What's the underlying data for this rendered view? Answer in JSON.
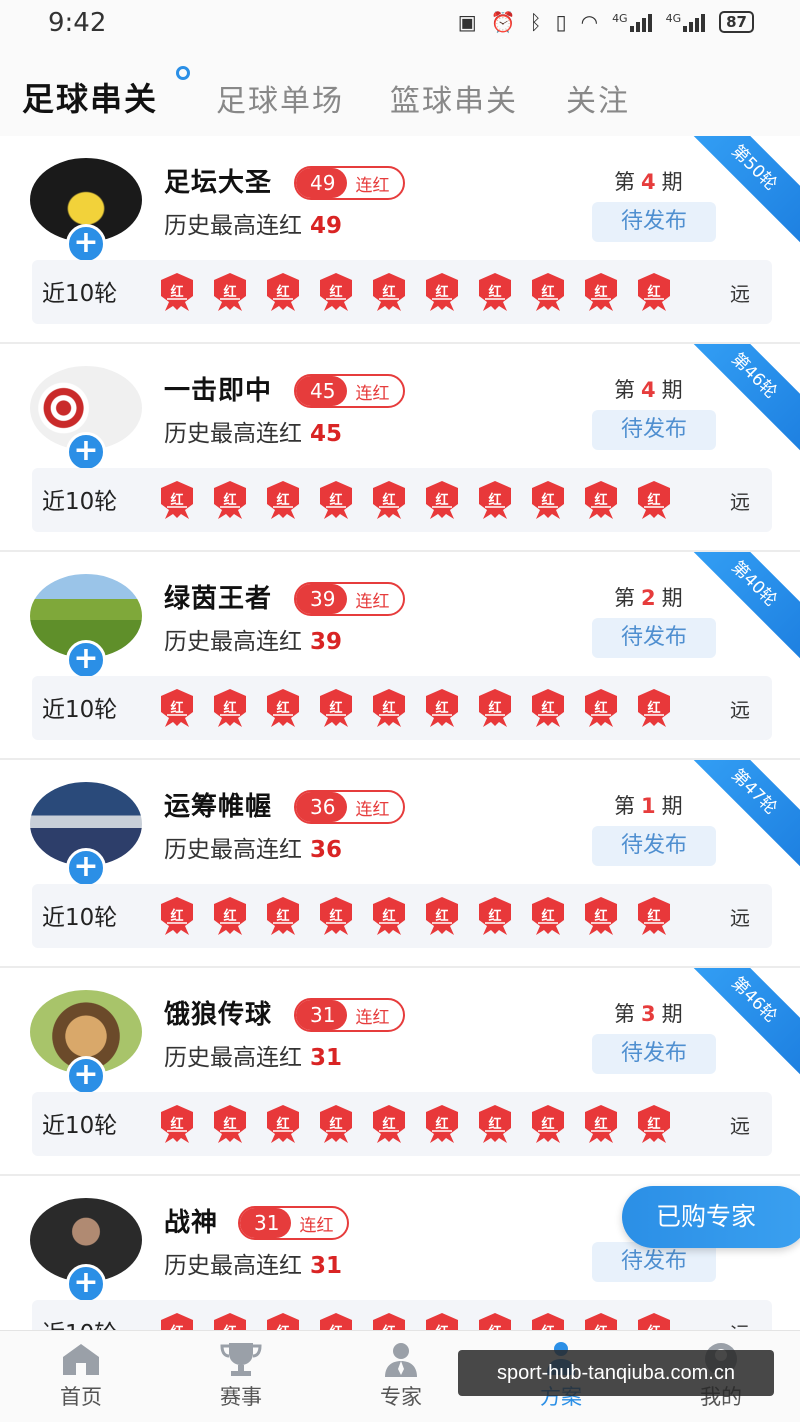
{
  "status_bar": {
    "time": "9:42",
    "network1": "4G",
    "network2": "4G",
    "battery": "87"
  },
  "tabs": [
    {
      "label": "足球串关",
      "active": true
    },
    {
      "label": "足球单场",
      "active": false
    },
    {
      "label": "篮球串关",
      "active": false
    },
    {
      "label": "关注",
      "active": false
    }
  ],
  "recent_label": "近10轮",
  "history_label": "历史最高连红",
  "streak_suffix": "连红",
  "badge_text": "红",
  "far_label": "远",
  "issue_prefix": "第",
  "issue_suffix": "期",
  "status_label": "待发布",
  "experts": [
    {
      "name": "足坛大圣",
      "streak": "49",
      "history_best": "49",
      "issue": "4",
      "round": "第50轮",
      "avatar": "sports-car-avatar"
    },
    {
      "name": "一击即中",
      "streak": "45",
      "history_best": "45",
      "issue": "4",
      "round": "第46轮",
      "avatar": "dart-target-avatar"
    },
    {
      "name": "绿茵王者",
      "streak": "39",
      "history_best": "39",
      "issue": "2",
      "round": "第40轮",
      "avatar": "grass-field-avatar"
    },
    {
      "name": "运筹帷幄",
      "streak": "36",
      "history_best": "36",
      "issue": "1",
      "round": "第47轮",
      "avatar": "football-player-avatar"
    },
    {
      "name": "饿狼传球",
      "streak": "31",
      "history_best": "31",
      "issue": "3",
      "round": "第46轮",
      "avatar": "cartoon-face-avatar"
    },
    {
      "name": "战神",
      "streak": "31",
      "history_best": "31",
      "issue": "",
      "round": "",
      "avatar": "man-portrait-avatar"
    }
  ],
  "bought_button": "已购专家",
  "bottom_nav": [
    {
      "label": "首页",
      "icon": "home-icon",
      "active": false
    },
    {
      "label": "赛事",
      "icon": "trophy-icon",
      "active": false
    },
    {
      "label": "专家",
      "icon": "expert-icon",
      "active": false
    },
    {
      "label": "方案",
      "icon": "plan-icon",
      "active": true
    },
    {
      "label": "我的",
      "icon": "profile-icon",
      "active": false
    }
  ],
  "watermark": "sport-hub-tanqiuba.com.cn",
  "colors": {
    "accent": "#2b8fe6",
    "red": "#e63c3c"
  }
}
